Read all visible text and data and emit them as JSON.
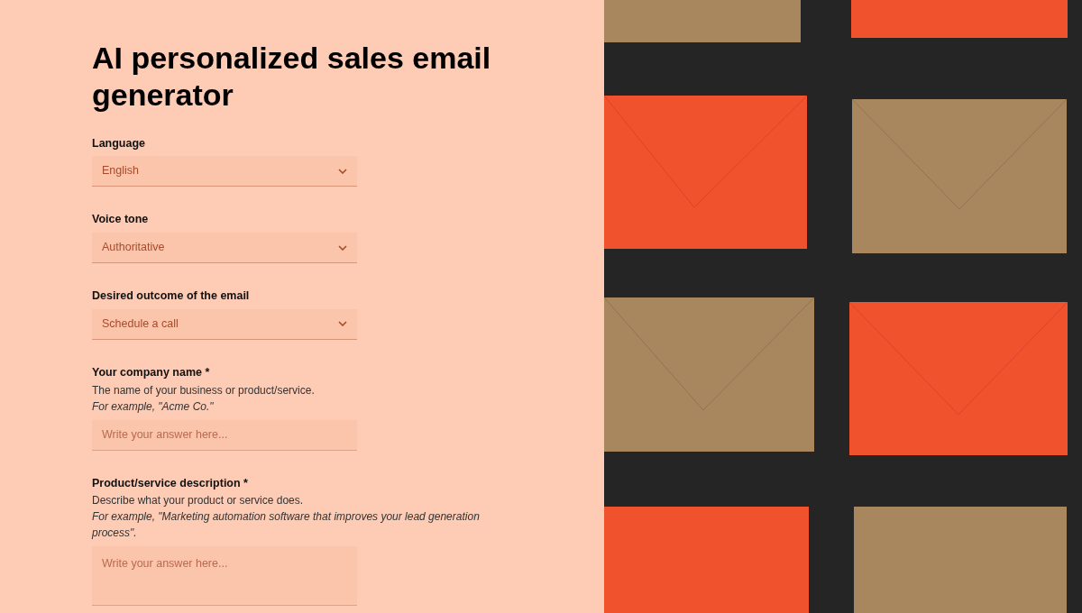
{
  "title": "AI personalized sales email generator",
  "fields": [
    {
      "kind": "select",
      "label": "Language",
      "value": "English"
    },
    {
      "kind": "select",
      "label": "Voice tone",
      "value": "Authoritative"
    },
    {
      "kind": "select",
      "label": "Desired outcome of the email",
      "value": "Schedule a call"
    },
    {
      "kind": "text",
      "label": "Your company name *",
      "help": "The name of your business or product/service.",
      "example": "For example, \"Acme Co.\"",
      "placeholder": "Write your answer here..."
    },
    {
      "kind": "textarea",
      "label": "Product/service description *",
      "help": "Describe what your product or service does.",
      "example": "For example, \"Marketing automation software that improves your lead generation process\".",
      "placeholder": "Write your answer here..."
    }
  ]
}
